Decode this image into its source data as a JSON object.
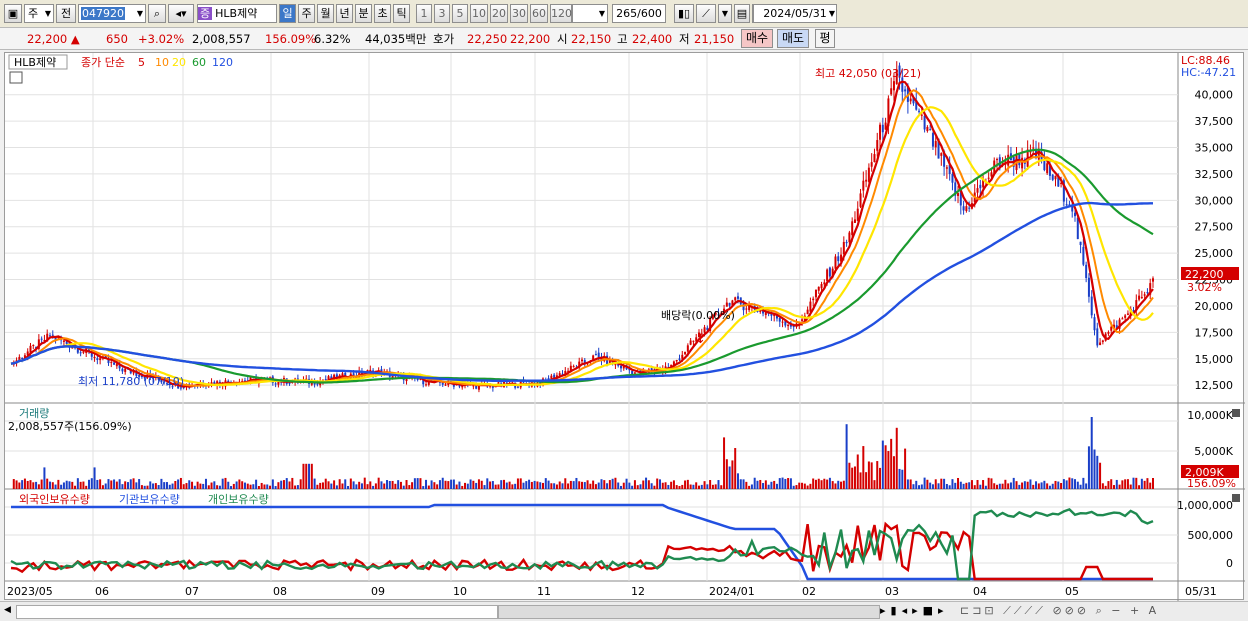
{
  "toolbar": {
    "market_type": "주",
    "prev_label": "전",
    "code": "047920",
    "stock_badge": "증",
    "stock_name": "HLB제약",
    "periods": [
      "일",
      "주",
      "월",
      "년",
      "분",
      "초",
      "틱"
    ],
    "active_period": "일",
    "intervals": [
      "1",
      "3",
      "5",
      "10",
      "20",
      "30",
      "60",
      "120"
    ],
    "count": "265",
    "count_max": "/600",
    "date": "2024/05/31"
  },
  "quote": {
    "price": "22,200",
    "change": "650",
    "change_pct": "+3.02%",
    "volume": "2,008,557",
    "volume_ratio": "156.09%",
    "turnover": "6.32%",
    "amount": "44,035백만",
    "ask_label": "호가",
    "ask": "22,250",
    "bid": "22,200",
    "open_label": "시",
    "open": "22,150",
    "high_label": "고",
    "high": "22,400",
    "low_label": "저",
    "low": "21,150",
    "buy_label": "매수",
    "sell_label": "매도",
    "eval_label": "평"
  },
  "price_panel": {
    "name": "HLB제약",
    "ma_label": "종가 단순",
    "ma_periods": [
      "5",
      "10",
      "20",
      "60",
      "120"
    ],
    "ma_colors": [
      "#d40000",
      "#ff8a00",
      "#ffe600",
      "#1a9a2e",
      "#2250e0"
    ],
    "lc": "LC:88.46",
    "hc": "HC:-47.21",
    "high_annotation": "최고 42,050 (03/21)",
    "low_annotation": "최저 11,780 (07/10)",
    "dividend_annotation": "배당락(0.00%)",
    "y_ticks": [
      "40,000",
      "37,500",
      "35,000",
      "32,500",
      "30,000",
      "27,500",
      "25,000",
      "22,500",
      "20,000",
      "17,500",
      "15,000",
      "12,500"
    ],
    "price_tag": "22,200",
    "pct_tag": "3.02%"
  },
  "volume_panel": {
    "title": "거래량",
    "value": "2,008,557주(156.09%)",
    "y_ticks": [
      "10,000K",
      "5,000K"
    ],
    "tag": "2,009K",
    "tag_pct": "156.09%"
  },
  "holding_panel": {
    "legends": [
      "외국인보유수량",
      "기관보유수량",
      "개인보유수량"
    ],
    "colors": [
      "#d40000",
      "#2250e0",
      "#1f8a50"
    ],
    "y_ticks": [
      "1,000,000",
      "500,000",
      "0"
    ]
  },
  "x_axis": [
    "2023/05",
    "06",
    "07",
    "08",
    "09",
    "10",
    "11",
    "12",
    "2024/01",
    "02",
    "03",
    "04",
    "05",
    "05/31"
  ],
  "chart_data": {
    "type": "candlestick",
    "series": [
      {
        "name": "종가",
        "x": [
          "2023/05",
          "2023/06",
          "2023/07",
          "2023/08",
          "2023/09",
          "2023/10",
          "2023/11",
          "2023/12",
          "2024/01",
          "2024/02",
          "2024/03",
          "2024/04",
          "2024/05",
          "05/31"
        ],
        "values": [
          14500,
          15200,
          12500,
          12800,
          13200,
          12800,
          12600,
          12800,
          14300,
          20000,
          38000,
          31000,
          33000,
          22200
        ]
      }
    ],
    "ylim": [
      11000,
      43000
    ]
  }
}
